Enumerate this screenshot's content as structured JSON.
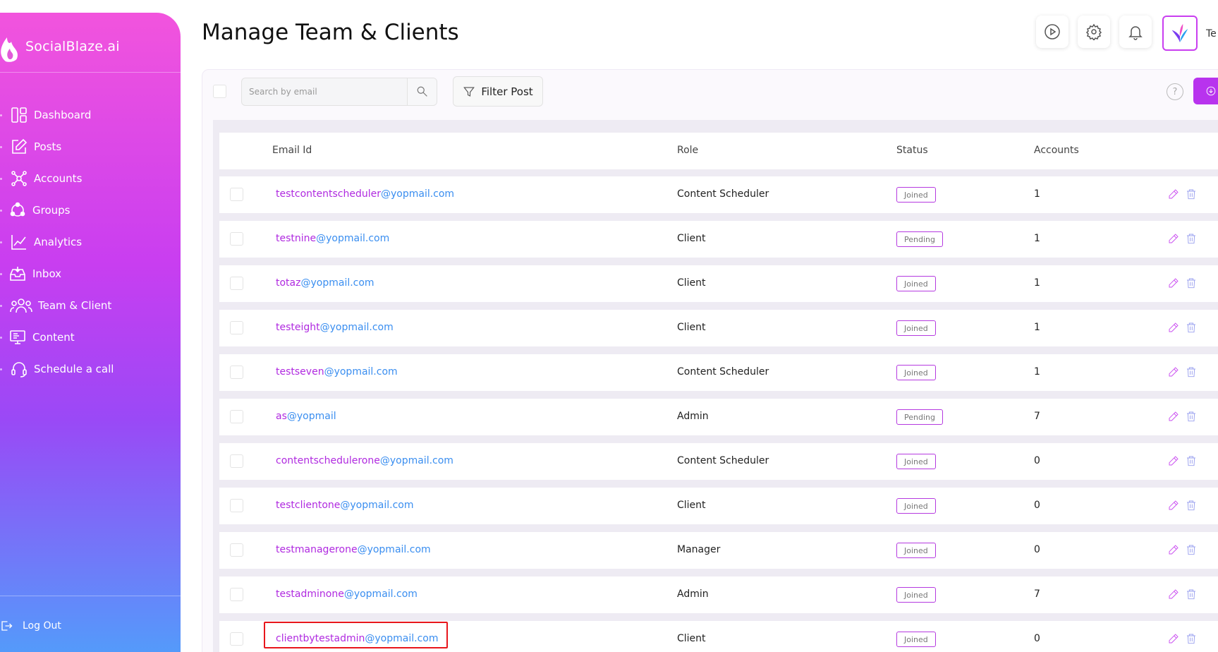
{
  "brand": {
    "name": "SocialBlaze.ai"
  },
  "sidebar": {
    "items": [
      {
        "label": "Dashboard",
        "icon": "dashboard-icon"
      },
      {
        "label": "Posts",
        "icon": "edit-square-icon"
      },
      {
        "label": "Accounts",
        "icon": "network-icon"
      },
      {
        "label": "Groups",
        "icon": "groups-icon"
      },
      {
        "label": "Analytics",
        "icon": "analytics-chart-icon"
      },
      {
        "label": "Inbox",
        "icon": "inbox-icon"
      },
      {
        "label": "Team & Client",
        "icon": "team-icon"
      },
      {
        "label": "Content",
        "icon": "content-monitor-icon"
      },
      {
        "label": "Schedule a call",
        "icon": "headset-icon"
      }
    ],
    "logout_label": "Log Out"
  },
  "header": {
    "title": "Manage Team & Clients",
    "user_name_partial": "Te"
  },
  "toolbar": {
    "search_placeholder": "Search by email",
    "filter_label": "Filter Post",
    "help_label": "?"
  },
  "table": {
    "columns": {
      "email": "Email Id",
      "role": "Role",
      "status": "Status",
      "accounts": "Accounts"
    },
    "rows": [
      {
        "email_a": "testcontentscheduler",
        "email_b": "@yopmail.com",
        "role": "Content Scheduler",
        "status": "Joined",
        "accounts": "1"
      },
      {
        "email_a": "testnine",
        "email_b": "@yopmail.com",
        "role": "Client",
        "status": "Pending",
        "accounts": "1"
      },
      {
        "email_a": "totaz",
        "email_b": "@yopmail.com",
        "role": "Client",
        "status": "Joined",
        "accounts": "1"
      },
      {
        "email_a": "testeight",
        "email_b": "@yopmail.com",
        "role": "Client",
        "status": "Joined",
        "accounts": "1"
      },
      {
        "email_a": "testseven",
        "email_b": "@yopmail.com",
        "role": "Content Scheduler",
        "status": "Joined",
        "accounts": "1"
      },
      {
        "email_a": "as",
        "email_b": "@yopmail",
        "role": "Admin",
        "status": "Pending",
        "accounts": "7"
      },
      {
        "email_a": "contentschedulerone",
        "email_b": "@yopmail.com",
        "role": "Content Scheduler",
        "status": "Joined",
        "accounts": "0"
      },
      {
        "email_a": "testclientone",
        "email_b": "@yopmail.com",
        "role": "Client",
        "status": "Joined",
        "accounts": "0"
      },
      {
        "email_a": "testmanagerone",
        "email_b": "@yopmail.com",
        "role": "Manager",
        "status": "Joined",
        "accounts": "0"
      },
      {
        "email_a": "testadminone",
        "email_b": "@yopmail.com",
        "role": "Admin",
        "status": "Joined",
        "accounts": "7"
      },
      {
        "email_a": "clientbytestadmin",
        "email_b": "@yopmail.com",
        "role": "Client",
        "status": "Joined",
        "accounts": "0"
      }
    ]
  },
  "colors": {
    "accent": "#b833ee",
    "email_purple": "#b02ae0",
    "email_blue": "#3a8ef0",
    "highlight": "#e8161c"
  }
}
